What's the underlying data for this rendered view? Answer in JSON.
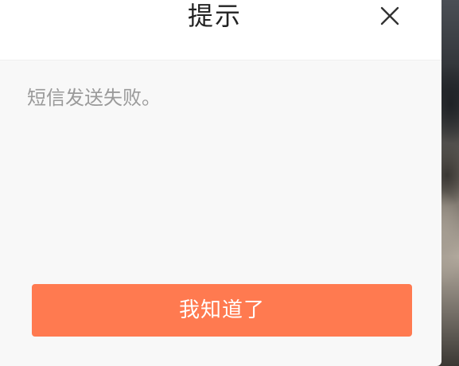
{
  "dialog": {
    "title": "提示",
    "message": "短信发送失败。",
    "confirm_label": "我知道了",
    "close_icon": "close-icon"
  },
  "colors": {
    "confirm_button": "#ff7a50",
    "message_text": "#9a9a9a",
    "title_text": "#222222"
  }
}
